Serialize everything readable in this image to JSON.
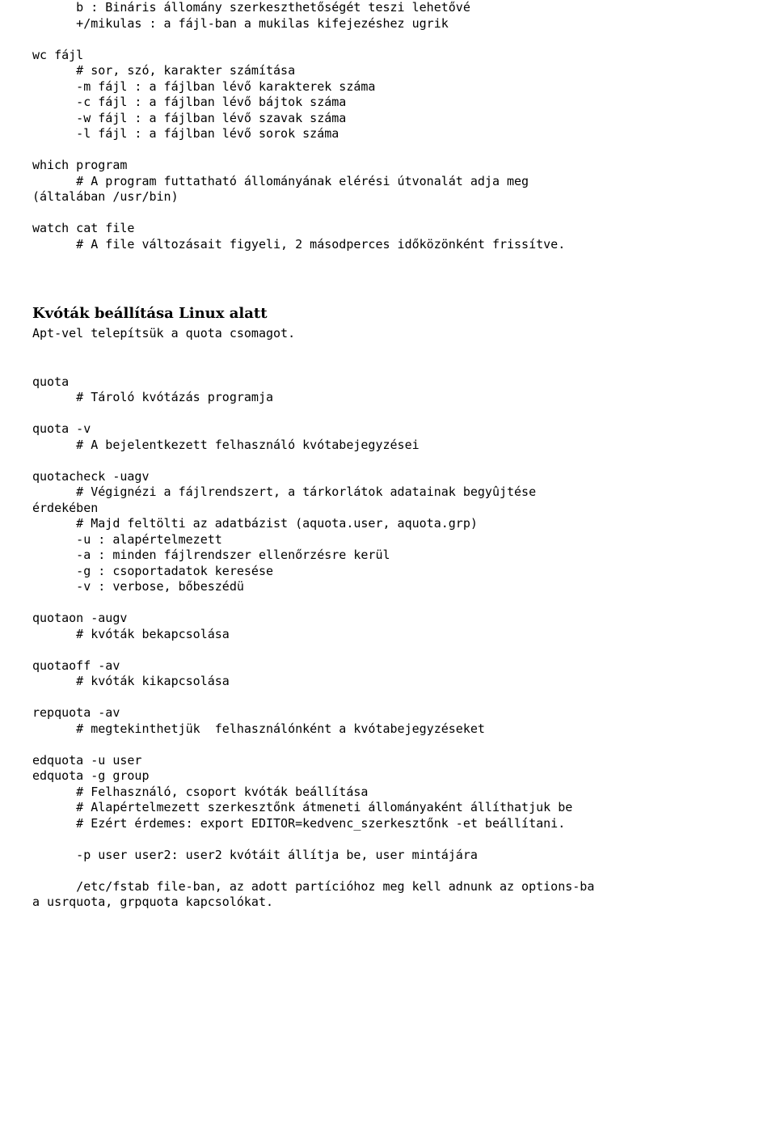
{
  "block1": "      b : Bináris állomány szerkeszthetőségét teszi lehetővé\n      +/mikulas : a fájl-ban a mukilas kifejezéshez ugrik\n\nwc fájl\n      # sor, szó, karakter számítása\n      -m fájl : a fájlban lévő karakterek száma\n      -c fájl : a fájlban lévő bájtok száma\n      -w fájl : a fájlban lévő szavak száma\n      -l fájl : a fájlban lévő sorok száma\n\nwhich program\n      # A program futtatható állományának elérési útvonalát adja meg\n(általában /usr/bin)\n\nwatch cat file\n      # A file változásait figyeli, 2 másodperces időközönként frissítve.",
  "heading": "Kvóták beállítása Linux alatt",
  "block2a": "Apt-vel telepítsük a quota csomagot.",
  "block2": "quota\n      # Tároló kvótázás programja\n\nquota -v\n      # A bejelentkezett felhasználó kvótabejegyzései\n\nquotacheck -uagv\n      # Végignézi a fájlrendszert, a tárkorlátok adatainak begyûjtése\nérdekében\n      # Majd feltölti az adatbázist (aquota.user, aquota.grp)\n      -u : alapértelmezett\n      -a : minden fájlrendszer ellenőrzésre kerül\n      -g : csoportadatok keresése\n      -v : verbose, bőbeszédü\n\nquotaon -augv\n      # kvóták bekapcsolása\n\nquotaoff -av\n      # kvóták kikapcsolása\n\nrepquota -av\n      # megtekinthetjük  felhasználónként a kvótabejegyzéseket\n\nedquota -u user\nedquota -g group\n      # Felhasználó, csoport kvóták beállítása\n      # Alapértelmezett szerkesztőnk átmeneti állományaként állíthatjuk be\n      # Ezért érdemes: export EDITOR=kedvenc_szerkesztőnk -et beállítani.\n\n      -p user user2: user2 kvótáit állítja be, user mintájára\n\n      /etc/fstab file-ban, az adott partícióhoz meg kell adnunk az options-ba\na usrquota, grpquota kapcsolókat."
}
